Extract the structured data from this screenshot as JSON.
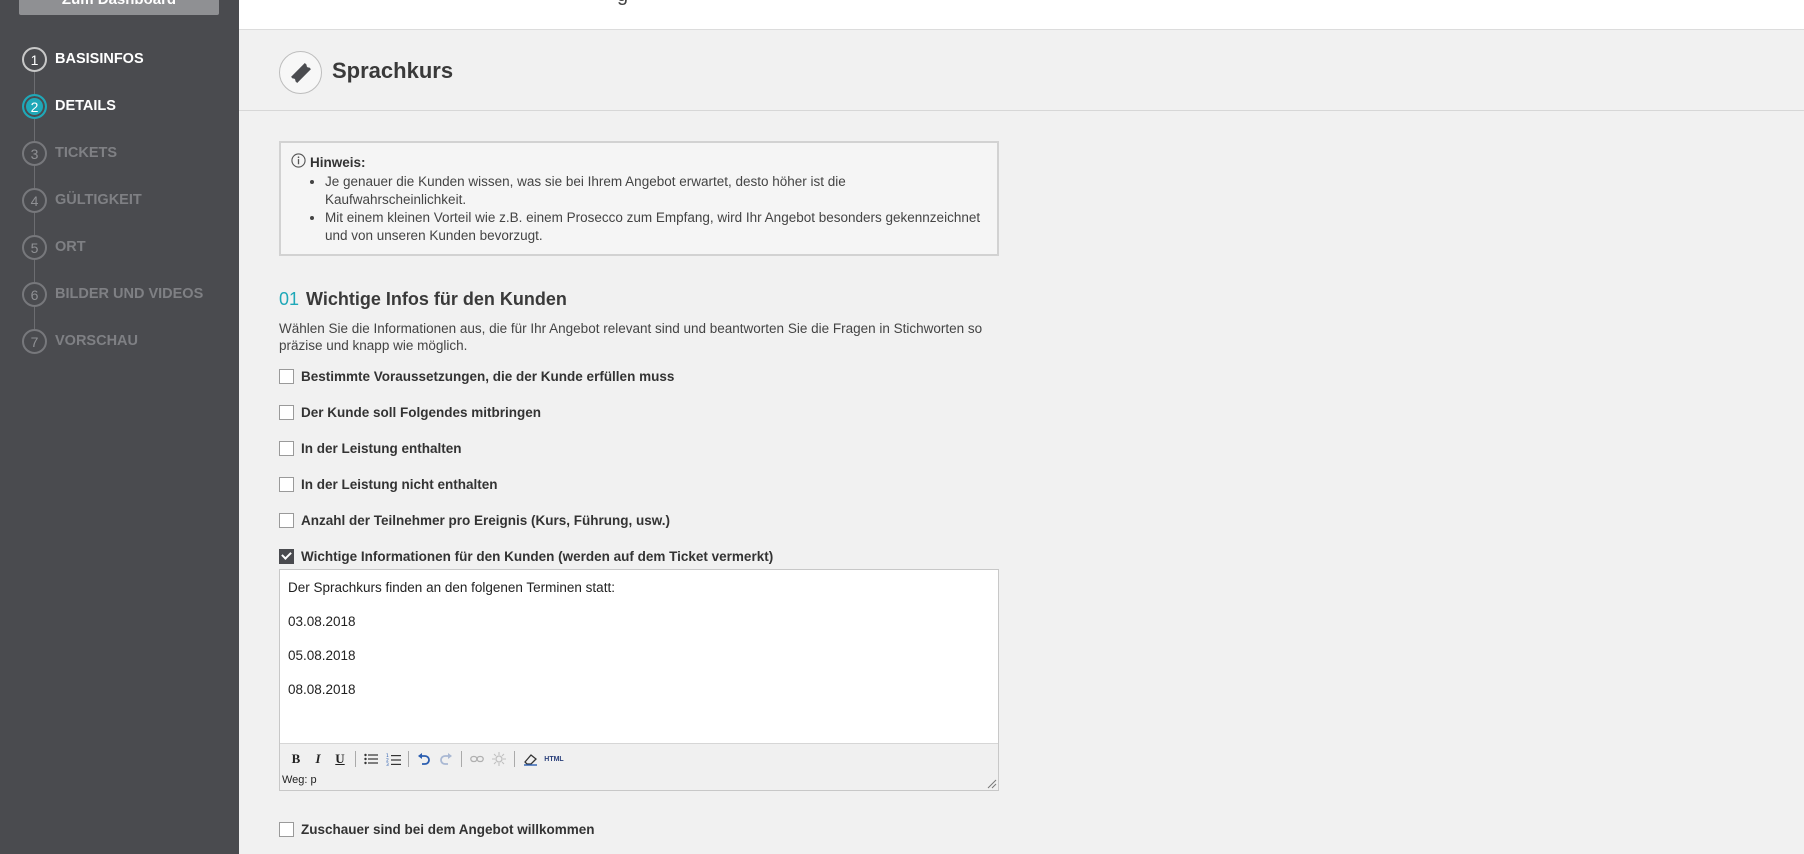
{
  "sidebar": {
    "dashboard_button": "Zum Dashboard",
    "steps": [
      {
        "num": "1",
        "label": "BASISINFOS"
      },
      {
        "num": "2",
        "label": "DETAILS"
      },
      {
        "num": "3",
        "label": "TICKETS"
      },
      {
        "num": "4",
        "label": "GÜLTIGKEIT"
      },
      {
        "num": "5",
        "label": "ORT"
      },
      {
        "num": "6",
        "label": "BILDER UND VIDEOS"
      },
      {
        "num": "7",
        "label": "VORSCHAU"
      }
    ]
  },
  "topbar": {
    "fragment": "g"
  },
  "header": {
    "title": "Sprachkurs",
    "icon": "ticket-icon"
  },
  "notice": {
    "title": "Hinweis:",
    "items": [
      "Je genauer die Kunden wissen, was sie bei Ihrem Angebot erwartet, desto höher ist die Kaufwahrscheinlichkeit.",
      "Mit einem kleinen Vorteil wie z.B. einem Prosecco zum Empfang, wird Ihr Angebot besonders gekennzeichnet und von unseren Kunden bevorzugt."
    ]
  },
  "section": {
    "number": "01",
    "title": "Wichtige Infos für den Kunden",
    "description": "Wählen Sie die Informationen aus, die für Ihr Angebot relevant sind und beantworten Sie die Fragen in Stichworten so präzise und knapp wie möglich."
  },
  "checkboxes": [
    {
      "label": "Bestimmte Voraussetzungen, die der Kunde erfüllen muss",
      "checked": false
    },
    {
      "label": "Der Kunde soll Folgendes mitbringen",
      "checked": false
    },
    {
      "label": "In der Leistung enthalten",
      "checked": false
    },
    {
      "label": "In der Leistung nicht enthalten",
      "checked": false
    },
    {
      "label": "Anzahl der Teilnehmer pro Ereignis (Kurs, Führung, usw.)",
      "checked": false
    },
    {
      "label": "Wichtige Informationen für den Kunden (werden auf dem Ticket vermerkt)",
      "checked": true
    }
  ],
  "editor": {
    "paragraphs": [
      "Der Sprachkurs finden an den folgenen Terminen statt:",
      "03.08.2018",
      "05.08.2018",
      "08.08.2018"
    ],
    "toolbar": {
      "bold": "B",
      "italic": "I",
      "underline": "U",
      "html": "HTML"
    },
    "path": "Weg: p"
  },
  "last_checkbox": {
    "label": "Zuschauer sind bei dem Angebot willkommen",
    "checked": false
  },
  "colors": {
    "accent": "#1fa8b8",
    "sidebar": "#4a4b4f"
  }
}
